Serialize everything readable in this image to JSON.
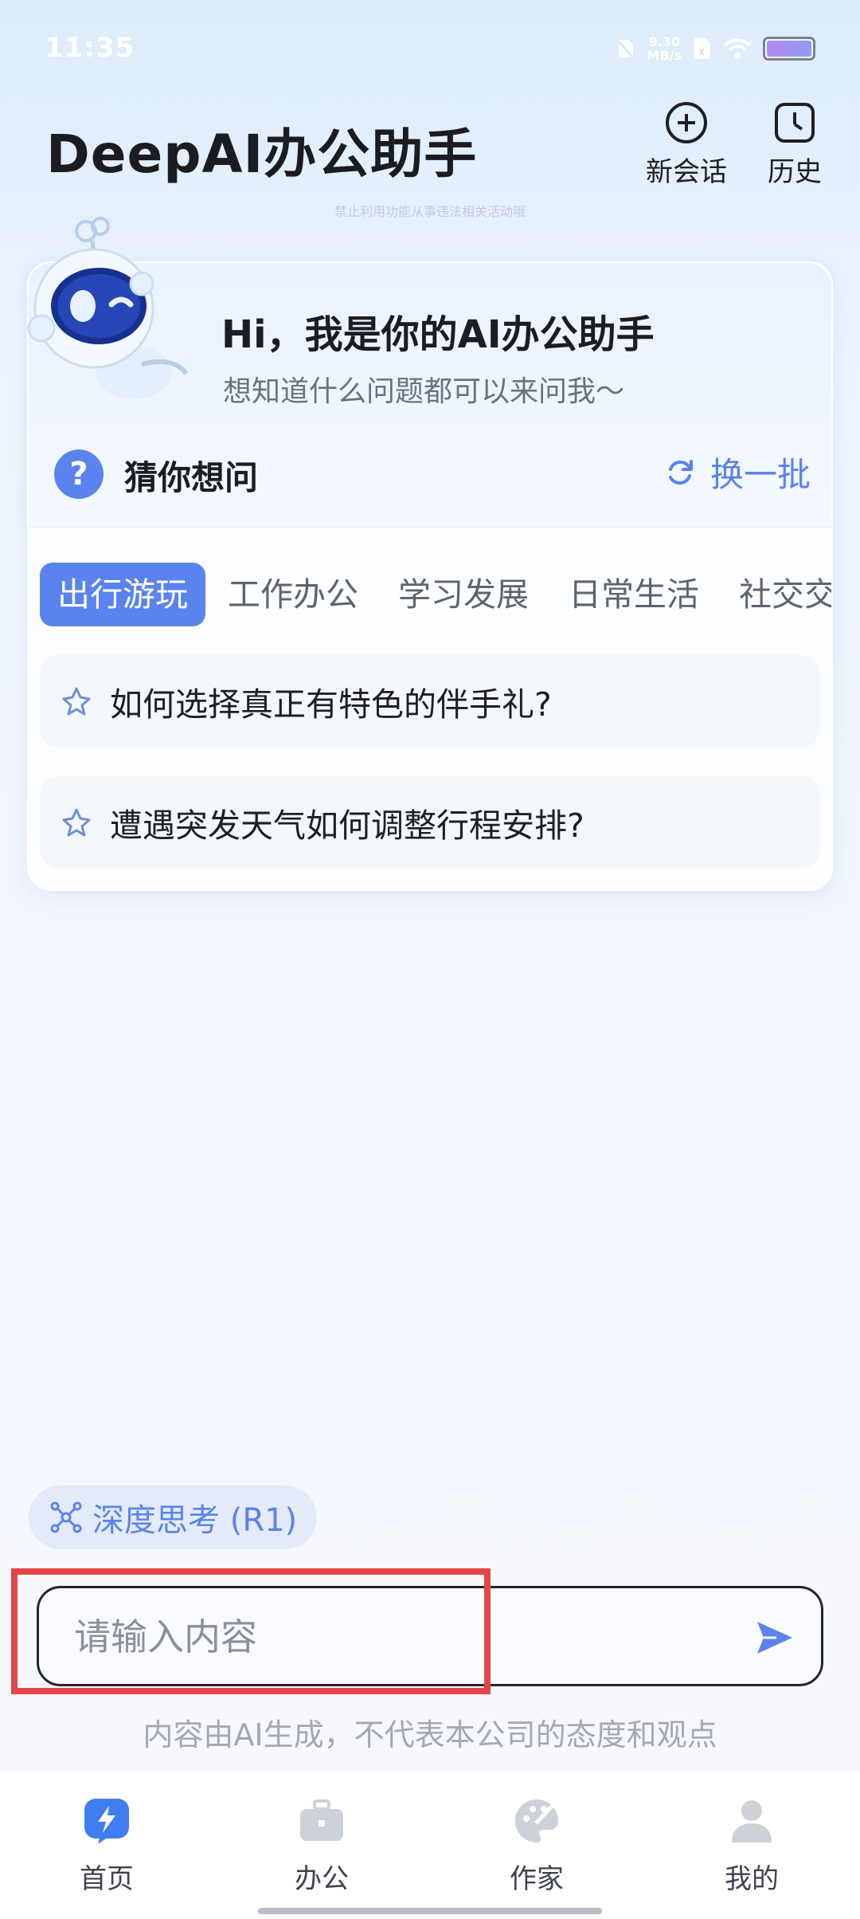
{
  "status_bar": {
    "time": "11:35",
    "net_speed": "9.30",
    "net_unit": "MB/s"
  },
  "header": {
    "title": "DeepAI办公助手",
    "new_chat_label": "新会话",
    "history_label": "历史",
    "watermark": "禁止利用功能从事违法相关活动哦"
  },
  "welcome": {
    "title": "Hi，我是你的AI办公助手",
    "subtitle": "想知道什么问题都可以来问我～",
    "guess_label": "猜你想问",
    "refresh_label": "换一批",
    "tabs": [
      {
        "label": "出行游玩",
        "active": true
      },
      {
        "label": "工作办公",
        "active": false
      },
      {
        "label": "学习发展",
        "active": false
      },
      {
        "label": "日常生活",
        "active": false
      },
      {
        "label": "社交交友",
        "active": false
      }
    ],
    "questions": [
      "如何选择真正有特色的伴手礼?",
      "遭遇突发天气如何调整行程安排?"
    ]
  },
  "deep_think": {
    "label": "深度思考 (R1)"
  },
  "input": {
    "placeholder": "请输入内容",
    "value": ""
  },
  "disclaimer": "内容由AI生成，不代表本公司的态度和观点",
  "tabbar": {
    "items": [
      {
        "label": "首页",
        "icon": "lightning-icon",
        "active": true
      },
      {
        "label": "办公",
        "icon": "briefcase-icon",
        "active": false
      },
      {
        "label": "作家",
        "icon": "palette-icon",
        "active": false
      },
      {
        "label": "我的",
        "icon": "person-icon",
        "active": false
      }
    ]
  },
  "colors": {
    "accent": "#5a83ef",
    "highlight_border": "#e5454a",
    "text_primary": "#1e1f24",
    "text_secondary": "#6b7180"
  }
}
